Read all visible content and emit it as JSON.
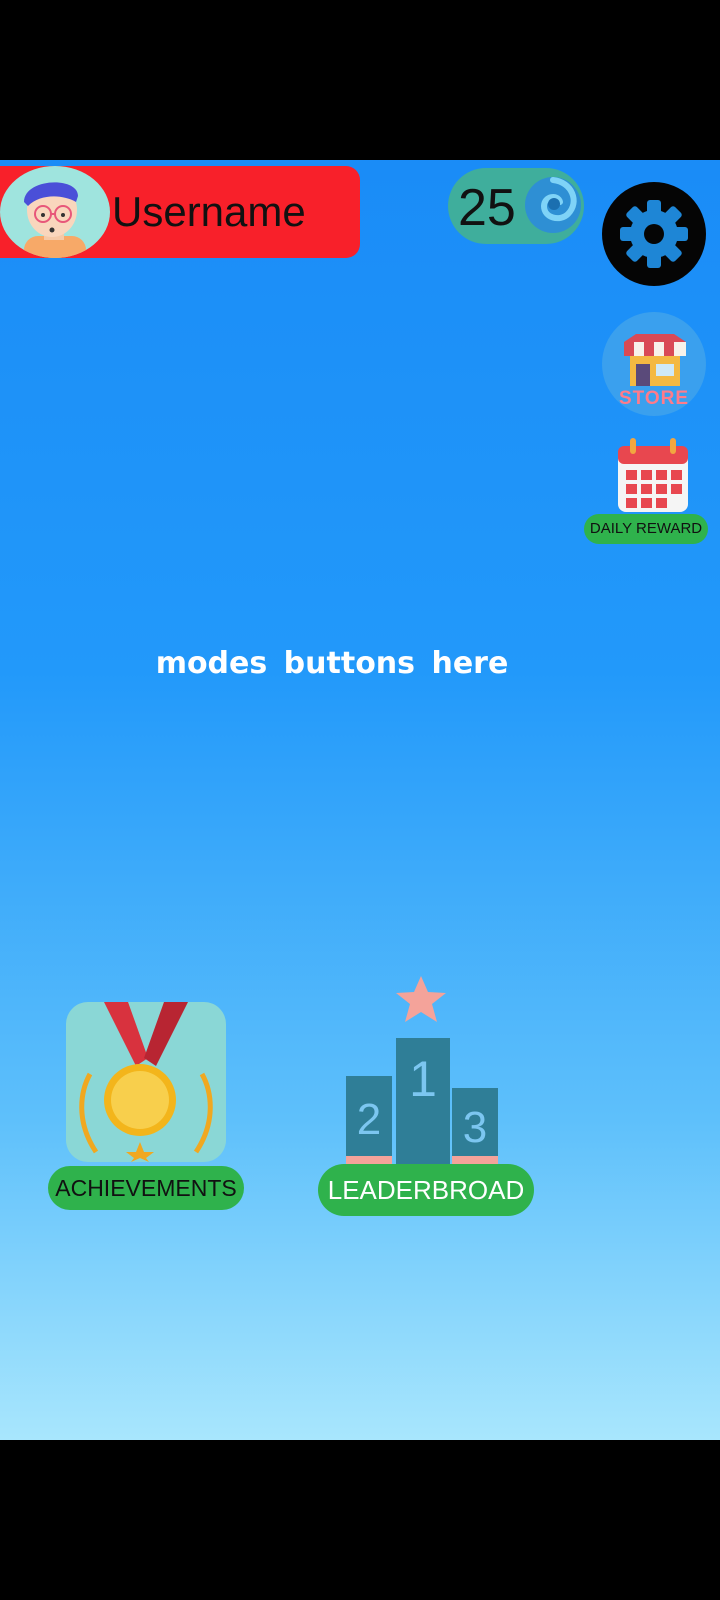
{
  "header": {
    "username": "Username",
    "coins": "25"
  },
  "side_buttons": {
    "store_label": "STORE",
    "daily_reward_label": "DAILY REWARD"
  },
  "main": {
    "placeholder": "modes buttons here"
  },
  "bottom": {
    "achievements_label": "ACHIEVEMENTS",
    "leaderboard_label": "LEADERBROAD",
    "podium_places": [
      "1",
      "2",
      "3"
    ]
  },
  "colors": {
    "user_bar": "#f8202a",
    "label_pill": "#2fb24c",
    "coin_pill": "#3fae9c"
  },
  "icons": [
    "avatar",
    "coin-swirl-icon",
    "gear-icon",
    "store-icon",
    "calendar-icon",
    "medal-icon",
    "podium-icon"
  ]
}
